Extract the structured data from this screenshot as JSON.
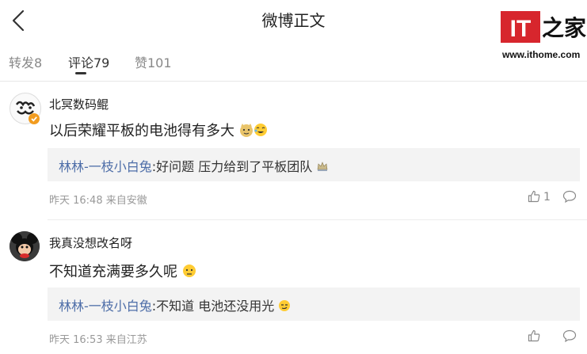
{
  "header": {
    "title": "微博正文"
  },
  "watermark": {
    "logo_text": "IT之家",
    "url": "www.ithome.com"
  },
  "tabs": [
    {
      "label": "转发8"
    },
    {
      "label": "评论79"
    },
    {
      "label": "赞101"
    }
  ],
  "comments": [
    {
      "author": "北冥数码鲲",
      "text": "以后荣耀平板的电池得有多大",
      "reply_user": "林林-一枝小白兔",
      "reply_text": ":好问题 压力给到了平板团队",
      "meta": "昨天 16:48 来自安徽",
      "likes": "1"
    },
    {
      "author": "我真没想改名呀",
      "text": "不知道充满要多久呢",
      "reply_user": "林林-一枝小白兔",
      "reply_text": ":不知道 电池还没用光",
      "meta": "昨天 16:53 来自江苏",
      "likes": ""
    }
  ],
  "colors": {
    "link": "#4e6ea8",
    "meta": "#999999",
    "reply_bg": "#f3f3f3",
    "logo_red": "#d7262d"
  }
}
